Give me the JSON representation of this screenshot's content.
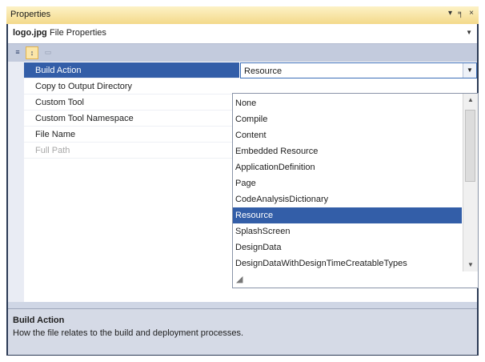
{
  "window": {
    "title": "Properties",
    "controls": {
      "pin": "▾",
      "dock": "╕",
      "close": "×"
    }
  },
  "object": {
    "name": "logo.jpg",
    "type": "File Properties",
    "dropdown_arrow": "▼"
  },
  "toolbar": {
    "buttons": [
      {
        "name": "categorized",
        "glyph": "≡"
      },
      {
        "name": "alphabetical",
        "glyph": "↕",
        "active": true
      },
      {
        "name": "property-pages",
        "glyph": "▭"
      }
    ]
  },
  "properties": [
    {
      "name": "Build Action",
      "value": "Resource",
      "selected": true
    },
    {
      "name": "Copy to Output Directory",
      "value": ""
    },
    {
      "name": "Custom Tool",
      "value": ""
    },
    {
      "name": "Custom Tool Namespace",
      "value": ""
    },
    {
      "name": "File Name",
      "value": ""
    },
    {
      "name": "Full Path",
      "value": "",
      "disabled": true
    }
  ],
  "build_action_dropdown": {
    "options": [
      "None",
      "Compile",
      "Content",
      "Embedded Resource",
      "ApplicationDefinition",
      "Page",
      "CodeAnalysisDictionary",
      "Resource",
      "SplashScreen",
      "DesignData",
      "DesignDataWithDesignTimeCreatableTypes"
    ],
    "selected": "Resource"
  },
  "description": {
    "title": "Build Action",
    "text": "How the file relates to the build and deployment processes."
  }
}
